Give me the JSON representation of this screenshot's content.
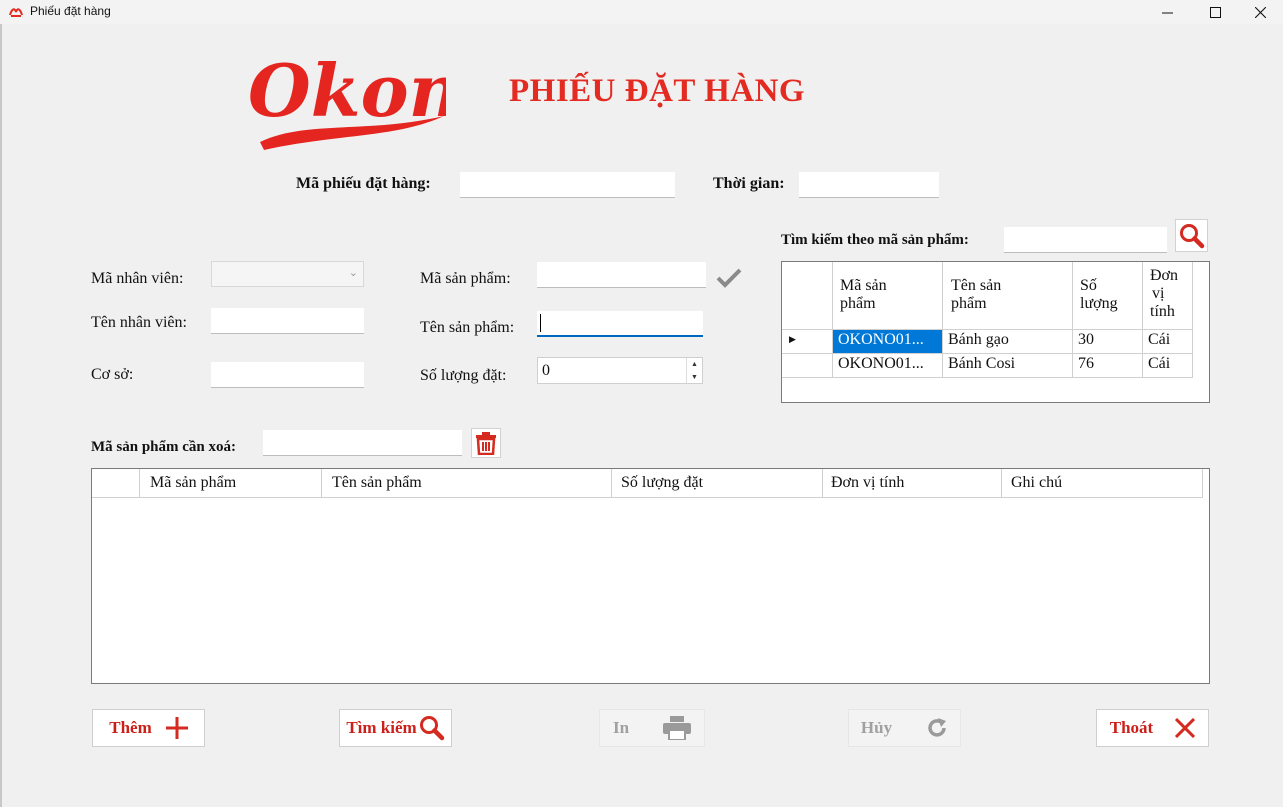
{
  "window": {
    "title": "Phiếu đặt hàng"
  },
  "logo_text": "Okono",
  "heading": "PHIẾU ĐẶT HÀNG",
  "order": {
    "id_label": "Mã phiếu đặt hàng:",
    "id_value": "",
    "time_label": "Thời gian:",
    "time_value": ""
  },
  "employee": {
    "id_label": "Mã nhân viên:",
    "id_value": "",
    "name_label": "Tên nhân viên:",
    "name_value": "",
    "branch_label": "Cơ sở:",
    "branch_value": ""
  },
  "product": {
    "id_label": "Mã sản phẩm:",
    "id_value": "",
    "name_label": "Tên sản phẩm:",
    "name_value": "",
    "qty_label": "Số lượng đặt:",
    "qty_value": "0"
  },
  "search": {
    "label": "Tìm kiếm theo mã sản phẩm:",
    "value": ""
  },
  "product_grid": {
    "columns": [
      {
        "l1": "Mã sản",
        "l2": "phẩm",
        "l3": ""
      },
      {
        "l1": "Tên sản",
        "l2": "phẩm",
        "l3": ""
      },
      {
        "l1": "Số",
        "l2": "lượng",
        "l3": ""
      },
      {
        "l1": "Đơn",
        "l2": "vị",
        "l3": "tính"
      }
    ],
    "rows": [
      [
        "OKONO01...",
        "Bánh gạo",
        "30",
        "Cái"
      ],
      [
        "OKONO01...",
        "Bánh Cosi",
        "76",
        "Cái"
      ]
    ]
  },
  "delete": {
    "label": "Mã sản phẩm cần xoá:",
    "value": ""
  },
  "order_grid": {
    "columns": [
      "Mã sản phẩm",
      "Tên sản phẩm",
      "Số lượng đặt",
      "Đơn vị tính",
      "Ghi chú"
    ]
  },
  "buttons": {
    "add": "Thêm",
    "search": "Tìm kiếm",
    "print": "In",
    "cancel": "Hủy",
    "exit": "Thoát"
  },
  "colors": {
    "accent": "#e32b22",
    "selection": "#0078d7"
  },
  "icons": [
    "app-icon",
    "minimize-icon",
    "maximize-icon",
    "close-icon",
    "check-icon",
    "search-icon",
    "trash-icon",
    "plus-icon",
    "printer-icon",
    "refresh-icon",
    "x-icon"
  ]
}
